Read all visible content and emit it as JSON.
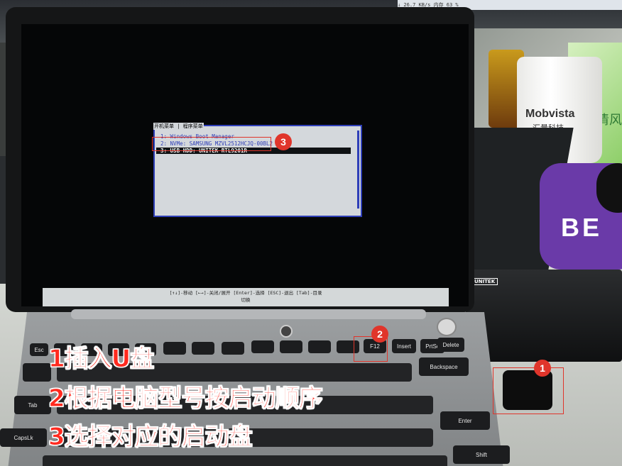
{
  "status_bar": {
    "text": "↓ 26.7 KB/s   内存 63 %"
  },
  "boot_menu": {
    "title": "开机菜单 | 程序菜单",
    "items": [
      "1: Windows Boot Manager",
      "2: NVMe: SAMSUNG MZVL2512HCJQ-00BL2",
      "3: USB HDD: UNITEK RTL9201R"
    ],
    "hint_line1": "[↑↓]-移动  [←→]-关闭/展开  [Enter]-选择  [ESC]-退出  [Tab]-目录",
    "hint_line2": "切换"
  },
  "captions": [
    "1插入U盘",
    "2根据电脑型号按启动顺序",
    "3选择对应的启动盘"
  ],
  "markers": [
    "1",
    "2",
    "3"
  ],
  "scene_labels": {
    "cup_brand": "Mobvista",
    "cup_sub": "汇量科技",
    "green_text": "清风",
    "mousepad_text": "BE",
    "dock_label": "UNITEK"
  },
  "keys": {
    "backspace": "Backspace",
    "delete": "Delete",
    "tab": "Tab",
    "caps": "CapsLk",
    "enter": "Enter",
    "shift": "Shift",
    "esc": "Esc",
    "f12": "F12",
    "insert": "Insert",
    "prtsc": "PrtSc"
  },
  "colors": {
    "annotation_red": "#e0352b",
    "boot_blue": "#2f3fb8"
  }
}
